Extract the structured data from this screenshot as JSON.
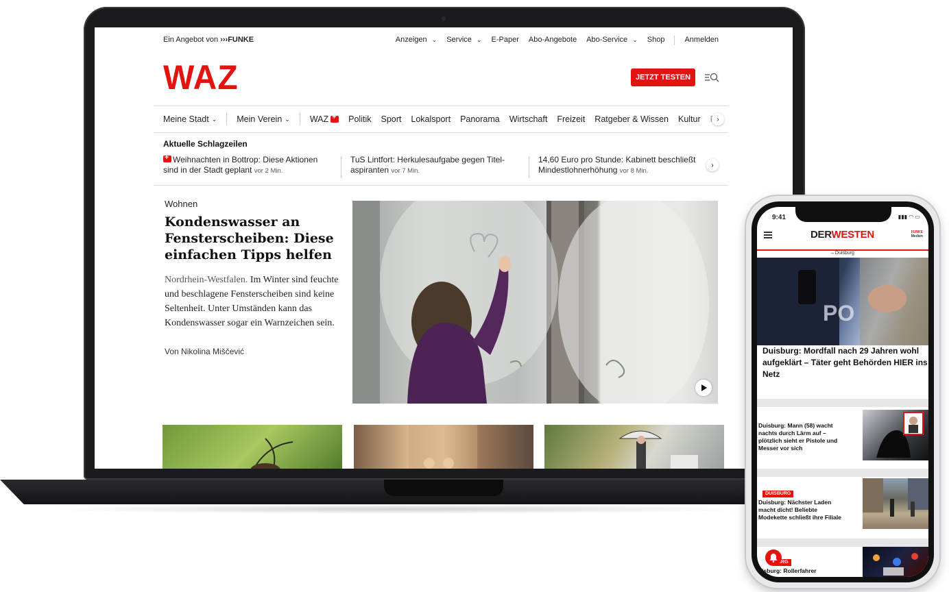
{
  "waz": {
    "util": {
      "offer_prefix": "Ein Angebot von",
      "funke": "FUNKE",
      "anzeigen": "Anzeigen",
      "service": "Service",
      "epaper": "E-Paper",
      "abo_angebote": "Abo-Angebote",
      "abo_service": "Abo-Service",
      "shop": "Shop",
      "login": "Anmelden"
    },
    "logo": "WAZ",
    "cta": "JETZT TESTEN",
    "nav": {
      "meine_stadt": "Meine Stadt",
      "mein_verein": "Mein Verein",
      "waz_plus": "WAZ",
      "politik": "Politik",
      "sport": "Sport",
      "lokalsport": "Lokalsport",
      "panorama": "Panorama",
      "wirtschaft": "Wirtschaft",
      "freizeit": "Freizeit",
      "ratgeber": "Ratgeber & Wissen",
      "kultur": "Kultur",
      "truncated": "P"
    },
    "headlines": {
      "title": "Aktuelle Schlagzeilen",
      "items": [
        {
          "line1": "Weihnachten in Bottrop: Diese Aktionen",
          "line2": "sind in der Stadt geplant",
          "time": "vor 2 Min."
        },
        {
          "line1": "TuS Lintfort: Herkulesaufgabe gegen Titel-",
          "line2": "aspiranten",
          "time": "vor 7 Min."
        },
        {
          "line1": "14,60 Euro pro Stunde: Kabinett beschließt",
          "line2": "Mindestlohnerhöhung",
          "time": "vor 8 Min."
        }
      ]
    },
    "lead": {
      "kicker": "Wohnen",
      "title": "Kondenswasser an Fensterscheiben: Diese einfachen Tipps helfen",
      "teaser_location": "Nordrhein-Westfalen.",
      "teaser": "Im Winter sind feuchte und beschlagene Fensterscheiben sind keine Seltenheit. Unter Umständen kann das Kondenswasser sogar ein Warnzeichen sein.",
      "author": "Von Nikolina Miščević"
    }
  },
  "derwesten": {
    "time": "9:41",
    "logo_der": "DER",
    "logo_westen": "WESTEN",
    "funke_line1": "FUNKE",
    "funke_line2": "Medien",
    "city": "– Duisburg",
    "hero_title": "Duisburg: Mordfall nach 29 Jahren wohl aufgeklärt – Täter geht Behörden HIER ins Netz",
    "items": [
      {
        "badge": "",
        "title": "Duisburg: Mann (58) wacht nachts durch Lärm auf – plötzlich sieht er Pistole und Messer vor sich"
      },
      {
        "badge": "DUISBURG",
        "title": "Duisburg: Nächster Laden macht dicht! Beliebte Modekette schließt ihre Filiale"
      },
      {
        "badge": "URG",
        "title": "uisburg: Rollerfahrer"
      }
    ]
  },
  "colors": {
    "waz_red": "#e3130f",
    "derwesten_red": "#e3130f"
  }
}
